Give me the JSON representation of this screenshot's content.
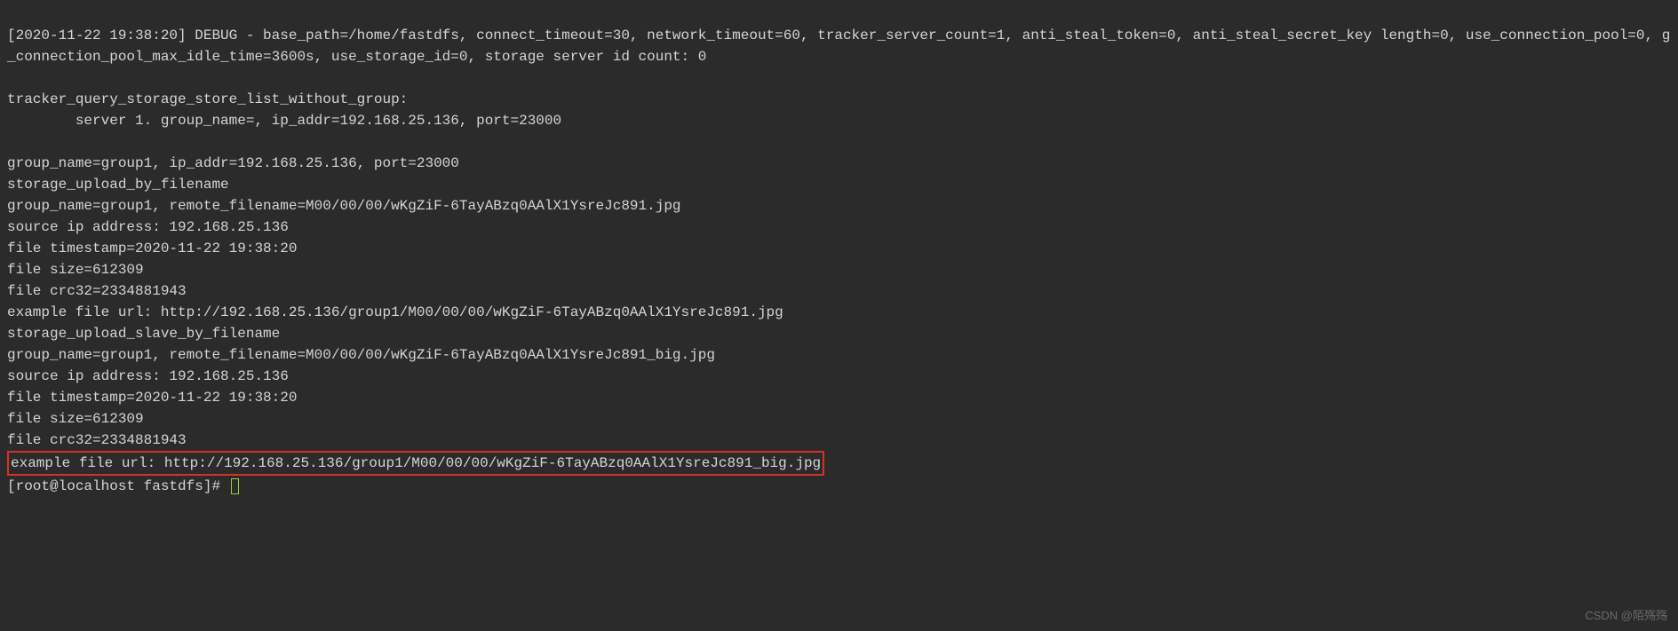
{
  "terminal": {
    "lines": {
      "l1": "[2020-11-22 19:38:20] DEBUG - base_path=/home/fastdfs, connect_timeout=30, network_timeout=60, tracker_server_count=1, anti_steal_token=0, anti_steal_secret_key length=0, use_connection_pool=0, g_connection_pool_max_idle_time=3600s, use_storage_id=0, storage server id count: 0",
      "l2": "",
      "l3": "tracker_query_storage_store_list_without_group: ",
      "l4": "        server 1. group_name=, ip_addr=192.168.25.136, port=23000",
      "l5": "",
      "l6": "group_name=group1, ip_addr=192.168.25.136, port=23000",
      "l7": "storage_upload_by_filename",
      "l8": "group_name=group1, remote_filename=M00/00/00/wKgZiF-6TayABzq0AAlX1YsreJc891.jpg",
      "l9": "source ip address: 192.168.25.136",
      "l10": "file timestamp=2020-11-22 19:38:20",
      "l11": "file size=612309",
      "l12": "file crc32=2334881943",
      "l13": "example file url: http://192.168.25.136/group1/M00/00/00/wKgZiF-6TayABzq0AAlX1YsreJc891.jpg",
      "l14": "storage_upload_slave_by_filename",
      "l15": "group_name=group1, remote_filename=M00/00/00/wKgZiF-6TayABzq0AAlX1YsreJc891_big.jpg",
      "l16": "source ip address: 192.168.25.136",
      "l17": "file timestamp=2020-11-22 19:38:20",
      "l18": "file size=612309",
      "l19": "file crc32=2334881943",
      "highlighted": "example file url: http://192.168.25.136/group1/M00/00/00/wKgZiF-6TayABzq0AAlX1YsreJc891_big.jpg",
      "prompt": "[root@localhost fastdfs]# "
    }
  },
  "watermark": "CSDN @陌殇殇"
}
